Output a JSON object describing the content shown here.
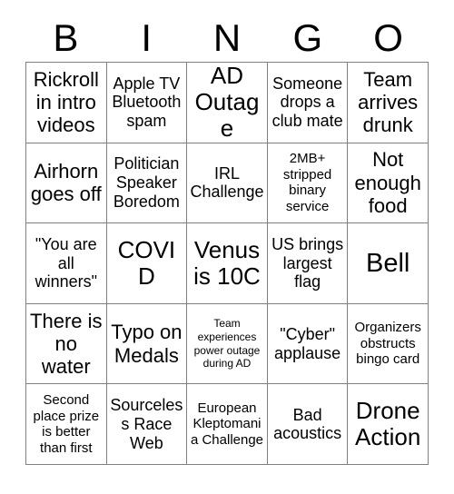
{
  "card": {
    "title": "BINGO",
    "header_letters": [
      "B",
      "I",
      "N",
      "G",
      "O"
    ],
    "grid_size": "5x5",
    "colors": {
      "background": "#ffffff",
      "text": "#000000",
      "grid_line": "#808080"
    },
    "rows": [
      [
        {
          "text": "Rickroll in intro videos",
          "size": "lg"
        },
        {
          "text": "Apple TV Bluetooth spam",
          "size": "md"
        },
        {
          "text": "AD Outage",
          "size": "xl"
        },
        {
          "text": "Someone drops a club mate",
          "size": "md"
        },
        {
          "text": "Team arrives drunk",
          "size": "lg"
        }
      ],
      [
        {
          "text": "Airhorn goes off",
          "size": "lg"
        },
        {
          "text": "Politician Speaker Boredom",
          "size": "md"
        },
        {
          "text": "IRL Challenge",
          "size": "md"
        },
        {
          "text": "2MB+ stripped binary service",
          "size": "sm"
        },
        {
          "text": "Not enough food",
          "size": "lg"
        }
      ],
      [
        {
          "text": "\"You are all winners\"",
          "size": "md"
        },
        {
          "text": "COVID",
          "size": "xl"
        },
        {
          "text": "Venus is 10C",
          "size": "xl"
        },
        {
          "text": "US brings largest flag",
          "size": "md"
        },
        {
          "text": "Bell",
          "size": "xxl"
        }
      ],
      [
        {
          "text": "There is no water",
          "size": "lg"
        },
        {
          "text": "Typo on Medals",
          "size": "lg"
        },
        {
          "text": "Team experiences power outage during AD",
          "size": "xs"
        },
        {
          "text": "\"Cyber\" applause",
          "size": "md"
        },
        {
          "text": "Organizers obstructs bingo card",
          "size": "sm"
        }
      ],
      [
        {
          "text": "Second place prize is better than first",
          "size": "sm"
        },
        {
          "text": "Sourceless Race Web",
          "size": "md"
        },
        {
          "text": "European Kleptomania Challenge",
          "size": "sm"
        },
        {
          "text": "Bad acoustics",
          "size": "md"
        },
        {
          "text": "Drone Action",
          "size": "xl"
        }
      ]
    ]
  }
}
